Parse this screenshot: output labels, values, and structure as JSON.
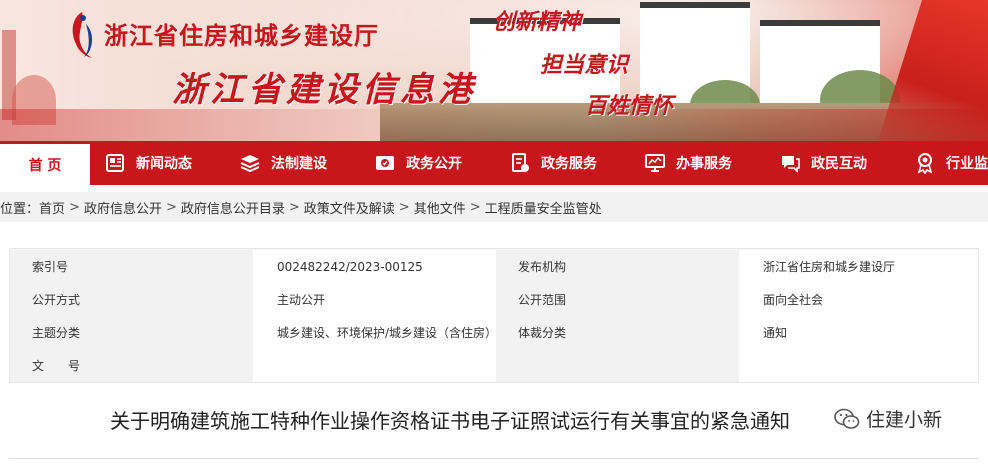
{
  "header": {
    "dept_name": "浙江省住房和城乡建设厅",
    "portal_name": "浙江省建设信息港",
    "slogans": [
      "创新精神",
      "担当意识",
      "百姓情怀"
    ]
  },
  "nav": [
    {
      "label": "首 页",
      "icon": "home"
    },
    {
      "label": "新闻动态",
      "icon": "news-icon"
    },
    {
      "label": "法制建设",
      "icon": "layers-icon"
    },
    {
      "label": "政务公开",
      "icon": "open-gov-icon"
    },
    {
      "label": "政务服务",
      "icon": "service-icon"
    },
    {
      "label": "办事服务",
      "icon": "monitor-icon"
    },
    {
      "label": "政民互动",
      "icon": "chat-icon"
    },
    {
      "label": "行业监",
      "icon": "medal-icon"
    }
  ],
  "breadcrumb": {
    "prefix": "位置：",
    "items": [
      "首页",
      "政府信息公开",
      "政府信息公开目录",
      "政策文件及解读",
      "其他文件",
      "工程质量安全监管处"
    ],
    "separator": ">"
  },
  "info": {
    "rows": [
      {
        "l1": "索引号",
        "v1": "002482242/2023-00125",
        "l2": "发布机构",
        "v2": "浙江省住房和城乡建设厅"
      },
      {
        "l1": "公开方式",
        "v1": "主动公开",
        "l2": "公开范围",
        "v2": "面向全社会"
      },
      {
        "l1": "主题分类",
        "v1": "城乡建设、环境保护/城乡建设（含住房）",
        "l2": "体裁分类",
        "v2": "通知"
      },
      {
        "l1": "文　　号",
        "v1": "",
        "l2": "",
        "v2": ""
      }
    ]
  },
  "document": {
    "title": "关于明确建筑施工特种作业操作资格证书电子证照试运行有关事宜的紧急通知"
  },
  "watermark": {
    "text": "住建小新"
  },
  "colors": {
    "brand_red": "#c8161d",
    "nav_bg": "#c8161d",
    "breadcrumb_bg": "#f2f2f2"
  }
}
